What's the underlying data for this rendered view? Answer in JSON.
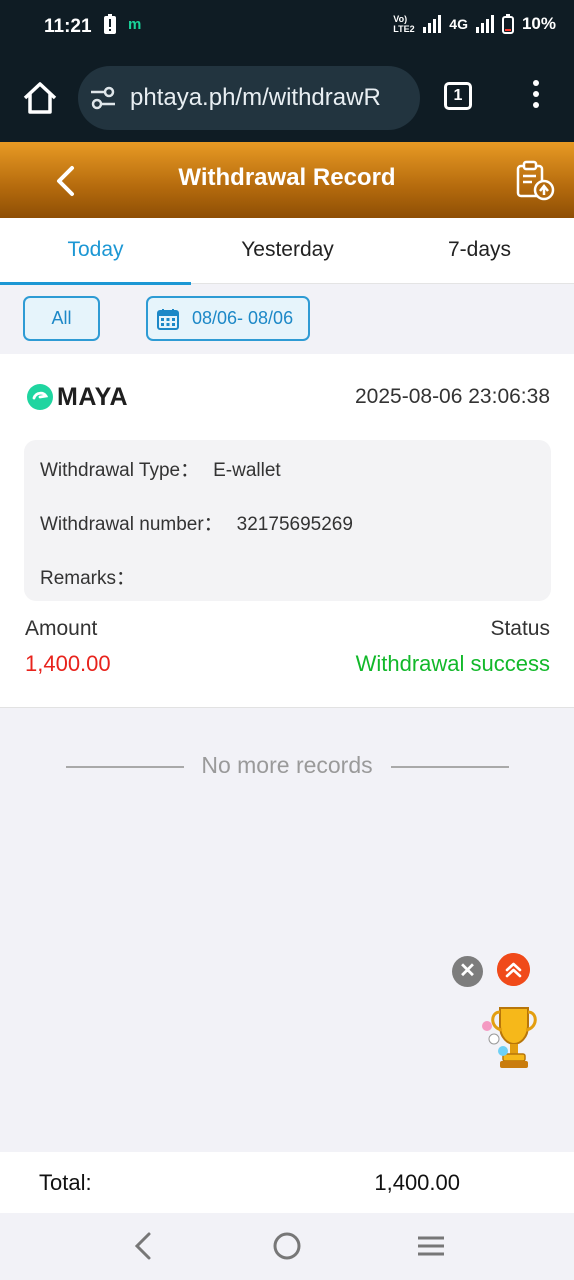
{
  "status_bar": {
    "time": "11:21",
    "carrier_tag": "Vo) LTE2",
    "network": "4G",
    "battery": "10%"
  },
  "browser": {
    "url": "phtaya.ph/m/withdrawR",
    "tab_count": "1"
  },
  "header": {
    "title": "Withdrawal Record"
  },
  "tabs": [
    {
      "label": "Today",
      "active": true
    },
    {
      "label": "Yesterday",
      "active": false
    },
    {
      "label": "7-days",
      "active": false
    }
  ],
  "filters": {
    "all_label": "All",
    "date_range": "08/06- 08/06"
  },
  "record": {
    "channel": "MAYA",
    "datetime": "2025-08-06 23:06:38",
    "type_label": "Withdrawal Type：",
    "type_value": "E-wallet",
    "number_label": "Withdrawal number：",
    "number_value": "32175695269",
    "remarks_label": "Remarks：",
    "remarks_value": "",
    "amount_label": "Amount",
    "amount_value": "1,400.00",
    "status_label": "Status",
    "status_value": "Withdrawal success"
  },
  "list_end_text": "No more records",
  "total": {
    "label": "Total:",
    "value": "1,400.00"
  },
  "colors": {
    "accent_blue": "#1c97d4",
    "header_orange": "#d98a1c",
    "amount_red": "#e8231c",
    "success_green": "#12b82a"
  }
}
